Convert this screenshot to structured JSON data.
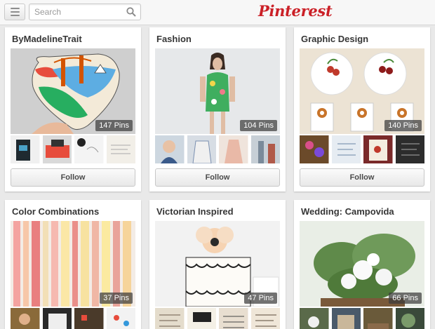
{
  "header": {
    "menu_icon": "hamburger-menu-icon",
    "search_placeholder": "Search",
    "search_icon": "magnifier-icon",
    "logo_text": "Pinterest",
    "logo_color": "#cb2027"
  },
  "boards": [
    {
      "title": "ByMadelineTrait",
      "pins": "147 Pins",
      "follow_label": "Follow"
    },
    {
      "title": "Fashion",
      "pins": "104 Pins",
      "follow_label": "Follow"
    },
    {
      "title": "Graphic Design",
      "pins": "140 Pins",
      "follow_label": "Follow"
    },
    {
      "title": "Color Combinations",
      "pins": "37 Pins"
    },
    {
      "title": "Victorian Inspired",
      "pins": "47 Pins"
    },
    {
      "title": "Wedding: Campovida",
      "pins": "66 Pins"
    }
  ]
}
